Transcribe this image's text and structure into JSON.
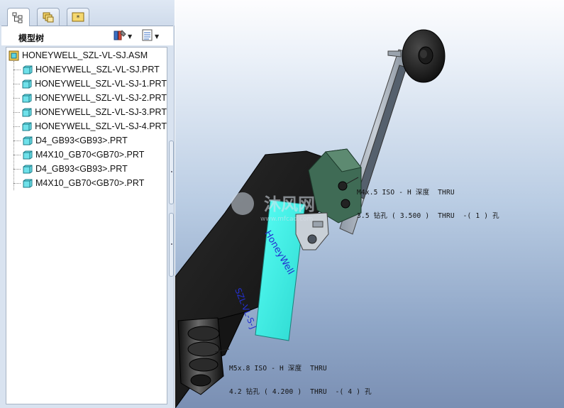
{
  "tabs": [
    {
      "icon": "model-tree-icon",
      "active": true
    },
    {
      "icon": "layers-icon",
      "active": false
    },
    {
      "icon": "favorites-star-icon",
      "active": false
    }
  ],
  "tree": {
    "title": "模型树",
    "settings_icon": "tree-settings-icon",
    "columns_icon": "tree-columns-icon",
    "root": {
      "label": "HONEYWELL_SZL-VL-SJ.ASM",
      "icon": "assembly-icon"
    },
    "items": [
      {
        "label": "HONEYWELL_SZL-VL-SJ.PRT",
        "icon": "part-icon"
      },
      {
        "label": "HONEYWELL_SZL-VL-SJ-1.PRT",
        "icon": "part-icon"
      },
      {
        "label": "HONEYWELL_SZL-VL-SJ-2.PRT",
        "icon": "part-icon"
      },
      {
        "label": "HONEYWELL_SZL-VL-SJ-3.PRT",
        "icon": "part-icon"
      },
      {
        "label": "HONEYWELL_SZL-VL-SJ-4.PRT",
        "icon": "part-icon"
      },
      {
        "label": "D4_GB93<GB93>.PRT",
        "icon": "part-icon"
      },
      {
        "label": "M4X10_GB70<GB70>.PRT",
        "icon": "part-icon"
      },
      {
        "label": "D4_GB93<GB93>.PRT",
        "icon": "part-icon"
      },
      {
        "label": "M4X10_GB70<GB70>.PRT",
        "icon": "part-icon"
      }
    ]
  },
  "viewport": {
    "annotation_top": {
      "line1": "M4x.5 ISO - H 深度  THRU",
      "line2": "3.5 钻孔 ( 3.500 )  THRU  -( 1 ) 孔"
    },
    "annotation_bottom": {
      "line1": "M5x.8 ISO - H 深度  THRU",
      "line2": "4.2 钻孔 ( 4.200 )  THRU  -( 4 ) 孔"
    },
    "model_brand_text": "HoneyWell",
    "model_part_text": "SZL-VL-S-J",
    "watermark_cn": "沐风网",
    "watermark_url": "www.mfcad.com",
    "body_color": "#3ef0e6"
  }
}
